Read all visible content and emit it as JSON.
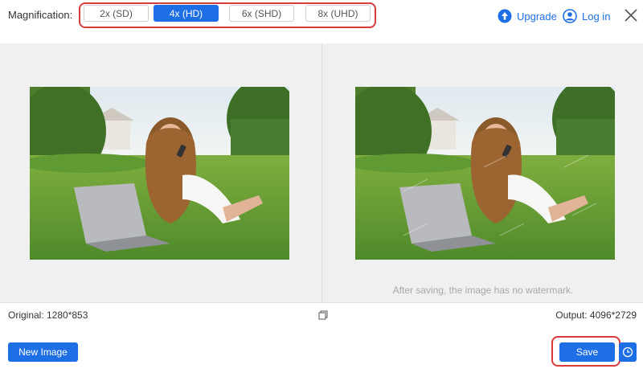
{
  "toolbar": {
    "magnification_label": "Magnification:",
    "options": [
      {
        "label": "2x (SD)",
        "selected": false
      },
      {
        "label": "4x (HD)",
        "selected": true
      },
      {
        "label": "6x (SHD)",
        "selected": false
      },
      {
        "label": "8x (UHD)",
        "selected": false
      }
    ],
    "upgrade_label": "Upgrade",
    "login_label": "Log in"
  },
  "preview": {
    "note": "After saving, the image has no watermark."
  },
  "info": {
    "original": "Original: 1280*853",
    "output": "Output: 4096*2729"
  },
  "actions": {
    "new_image_label": "New Image",
    "save_label": "Save"
  },
  "colors": {
    "accent": "#1e6fe6",
    "highlight_outline": "#d93a3a",
    "preview_bg": "#f0f0f0"
  }
}
